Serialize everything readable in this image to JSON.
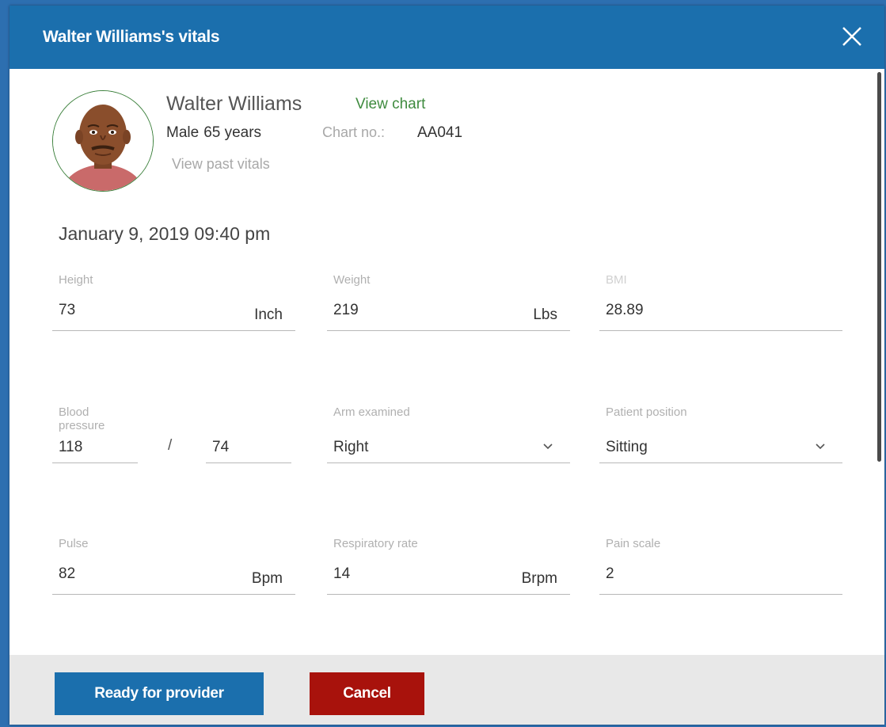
{
  "dialog": {
    "title": "Walter Williams's vitals"
  },
  "patient": {
    "name": "Walter Williams",
    "view_chart": "View chart",
    "sex": "Male",
    "age": "65 years",
    "chart_no_label": "Chart no.:",
    "chart_no": "AA041",
    "view_past_vitals": "View past vitals"
  },
  "datetime": "January 9, 2019 09:40 pm",
  "vitals": {
    "height": {
      "label": "Height",
      "value": "73",
      "unit": "Inch"
    },
    "weight": {
      "label": "Weight",
      "value": "219",
      "unit": "Lbs"
    },
    "bmi": {
      "label": "BMI",
      "value": "28.89"
    },
    "blood_pressure": {
      "label": "Blood pressure",
      "systolic": "118",
      "separator": "/",
      "diastolic": "74"
    },
    "arm_examined": {
      "label": "Arm examined",
      "value": "Right"
    },
    "patient_position": {
      "label": "Patient position",
      "value": "Sitting"
    },
    "pulse": {
      "label": "Pulse",
      "value": "82",
      "unit": "Bpm"
    },
    "respiratory_rate": {
      "label": "Respiratory rate",
      "value": "14",
      "unit": "Brpm"
    },
    "pain_scale": {
      "label": "Pain scale",
      "value": "2"
    }
  },
  "footer": {
    "ready_label": "Ready for provider",
    "cancel_label": "Cancel"
  },
  "colors": {
    "header": "#1b6fad",
    "primary_button": "#1b6fad",
    "cancel_button": "#a8120c",
    "link_green": "#3f8b3f"
  },
  "icons": [
    "close-icon",
    "chevron-down-icon",
    "avatar"
  ]
}
